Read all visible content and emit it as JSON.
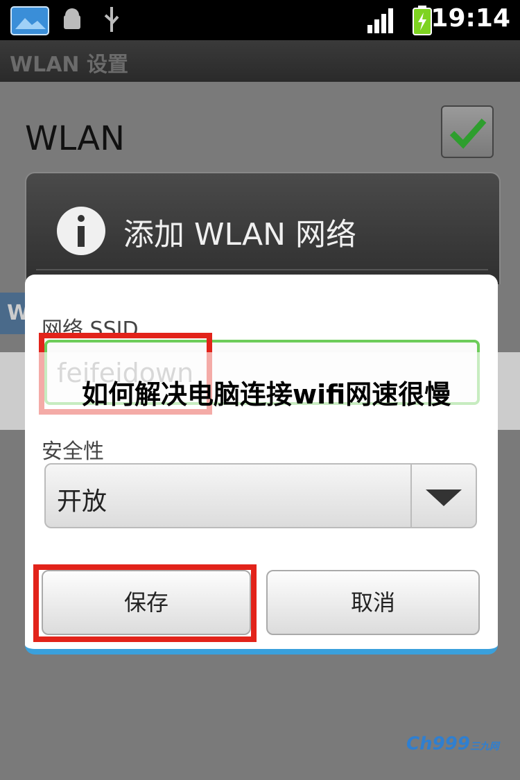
{
  "status_bar": {
    "time": "19:14",
    "icons": [
      "gallery-icon",
      "android-debug-icon",
      "usb-icon",
      "signal-icon",
      "battery-icon"
    ]
  },
  "title_bar": {
    "title": "WLAN 设置"
  },
  "background": {
    "wlan_label": "WLAN",
    "wlan_checked": true,
    "partial_item": "W"
  },
  "dialog": {
    "title": "添加 WLAN 网络",
    "ssid_label": "网络 SSID",
    "ssid_value": "feifeidown",
    "security_label": "安全性",
    "security_value": "开放",
    "save_label": "保存",
    "cancel_label": "取消"
  },
  "banner": {
    "text": "如何解决电脑连接wifi网速很慢"
  },
  "watermark": {
    "brand": "Ch999",
    "suffix": "三九网"
  },
  "colors": {
    "accent_blue": "#3aa0dc",
    "input_focus_green": "#6dcc5a",
    "highlight_red": "#e2231a"
  }
}
